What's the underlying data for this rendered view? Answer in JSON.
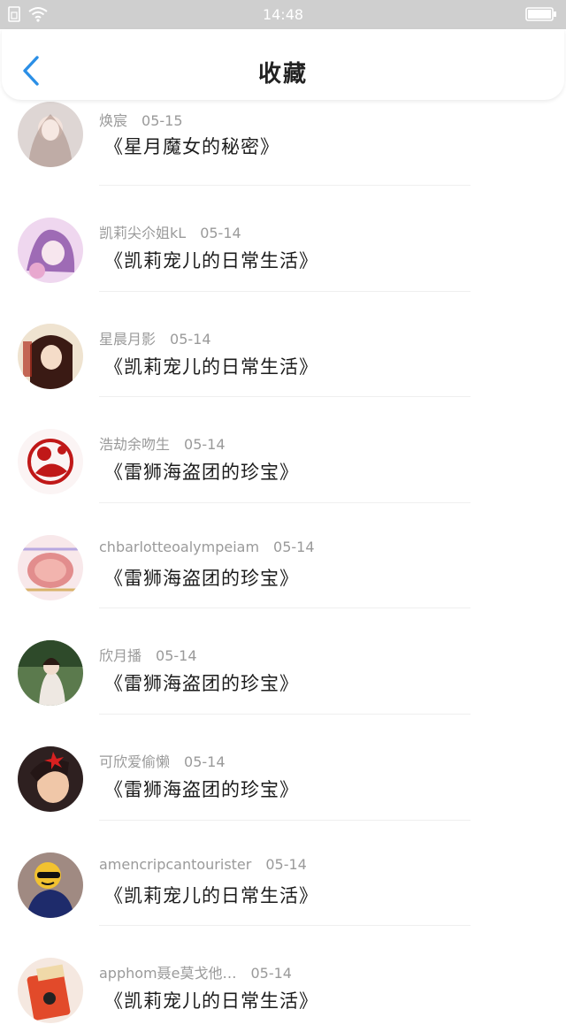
{
  "status_bar": {
    "time": "14:48"
  },
  "header": {
    "title": "收藏"
  },
  "colors": {
    "accent": "#2b8fe6",
    "status_bar_bg": "#cfcfcf"
  },
  "items": [
    {
      "username": "焕宸",
      "date": "05-15",
      "title": "《星月魔女的秘密》",
      "avatar_colors": [
        "#ded6d4",
        "#a68a80"
      ]
    },
    {
      "username": "凯莉尖尒姐kL",
      "date": "05-14",
      "title": "《凯莉宠儿的日常生活》",
      "avatar_colors": [
        "#efd7ef",
        "#9e6bb5"
      ]
    },
    {
      "username": "星晨月影",
      "date": "05-14",
      "title": "《凯莉宠儿的日常生活》",
      "avatar_colors": [
        "#efe3d0",
        "#7a3a2a"
      ]
    },
    {
      "username": "浩劫余吻生",
      "date": "05-14",
      "title": "《雷狮海盗团的珍宝》",
      "avatar_colors": [
        "#fbf4f4",
        "#c01818"
      ]
    },
    {
      "username": "chbarlotteoalympeiam",
      "date": "05-14",
      "title": "《雷狮海盗团的珍宝》",
      "avatar_colors": [
        "#f8e8ea",
        "#e28d8d"
      ]
    },
    {
      "username": "欣月播",
      "date": "05-14",
      "title": "《雷狮海盗团的珍宝》",
      "avatar_colors": [
        "#5b7a4d",
        "#eee8e2"
      ]
    },
    {
      "username": "可欣爱偷懒",
      "date": "05-14",
      "title": "《雷狮海盗团的珍宝》",
      "avatar_colors": [
        "#2e2020",
        "#f0c7a8"
      ]
    },
    {
      "username": "amencripcantourister",
      "date": "05-14",
      "title": "《凯莉宠儿的日常生活》",
      "avatar_colors": [
        "#a08a82",
        "#1e2b6b"
      ]
    },
    {
      "username": "apphom聂e莫戈他…",
      "date": "05-14",
      "title": "《凯莉宠儿的日常生活》",
      "avatar_colors": [
        "#f5e8e0",
        "#e24a2a"
      ]
    }
  ]
}
